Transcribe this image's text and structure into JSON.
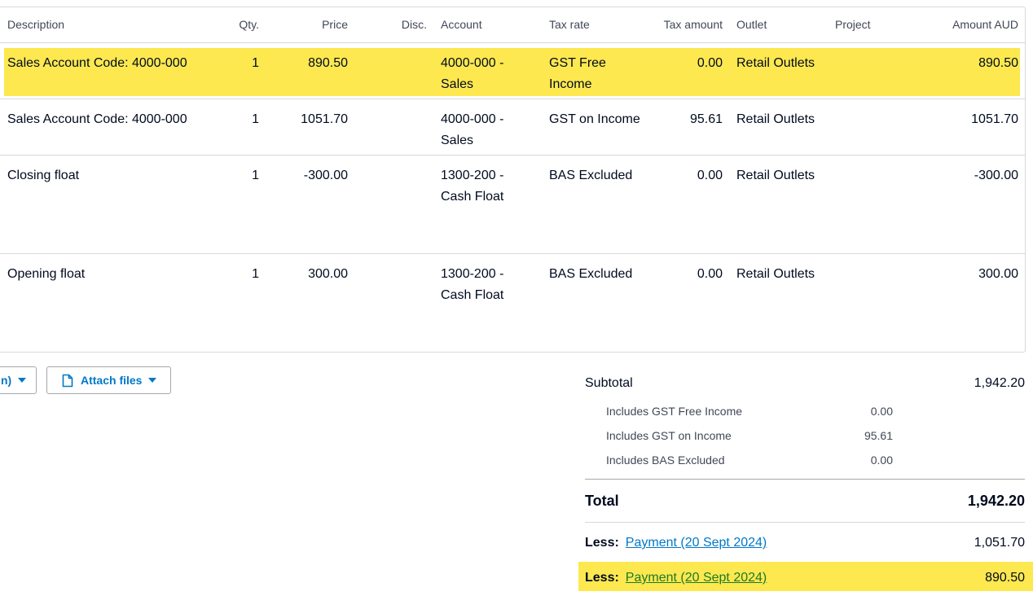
{
  "table": {
    "headers": {
      "description": "Description",
      "qty": "Qty.",
      "price": "Price",
      "disc": "Disc.",
      "account": "Account",
      "tax_rate": "Tax rate",
      "tax_amount": "Tax amount",
      "outlet": "Outlet",
      "project": "Project",
      "amount": "Amount AUD"
    },
    "rows": [
      {
        "description": "Sales Account Code: 4000-000",
        "qty": "1",
        "price": "890.50",
        "disc": "",
        "account_line1": "4000-000 -",
        "account_line2": "Sales",
        "tax_line1": "GST Free",
        "tax_line2": "Income",
        "tax_amount": "0.00",
        "outlet": "Retail Outlets",
        "project": "",
        "amount": "890.50",
        "highlighted": true
      },
      {
        "description": "Sales Account Code: 4000-000",
        "qty": "1",
        "price": "1051.70",
        "disc": "",
        "account_line1": "4000-000 -",
        "account_line2": "Sales",
        "tax_line1": "GST on Income",
        "tax_line2": "",
        "tax_amount": "95.61",
        "outlet": "Retail Outlets",
        "project": "",
        "amount": "1051.70",
        "highlighted": false
      },
      {
        "description": "Closing float",
        "qty": "1",
        "price": "-300.00",
        "disc": "",
        "account_line1": "1300-200 -",
        "account_line2": "Cash Float",
        "tax_line1": "BAS Excluded",
        "tax_line2": "",
        "tax_amount": "0.00",
        "outlet": "Retail Outlets",
        "project": "",
        "amount": "-300.00",
        "highlighted": false
      },
      {
        "description": "Opening float",
        "qty": "1",
        "price": "300.00",
        "disc": "",
        "account_line1": "1300-200 -",
        "account_line2": "Cash Float",
        "tax_line1": "BAS Excluded",
        "tax_line2": "",
        "tax_amount": "0.00",
        "outlet": "Retail Outlets",
        "project": "",
        "amount": "300.00",
        "highlighted": false
      }
    ]
  },
  "actions": {
    "left_button_label": "n)",
    "attach_label": "Attach files",
    "icons": {
      "caret": "chevron-down-icon",
      "attach": "document-icon"
    }
  },
  "totals": {
    "subtotal_label": "Subtotal",
    "subtotal_value": "1,942.20",
    "includes": [
      {
        "label": "Includes GST Free Income",
        "value": "0.00"
      },
      {
        "label": "Includes GST on Income",
        "value": "95.61"
      },
      {
        "label": "Includes BAS Excluded",
        "value": "0.00"
      }
    ],
    "total_label": "Total",
    "total_value": "1,942.20",
    "payments": [
      {
        "less_label": "Less:",
        "link_text": "Payment (20 Sept 2024)",
        "value": "1,051.70",
        "highlighted": false
      },
      {
        "less_label": "Less:",
        "link_text": "Payment (20 Sept 2024)",
        "value": "890.50",
        "highlighted": true
      }
    ]
  },
  "colors": {
    "highlight": "#fde84f",
    "link_blue": "#0078c8",
    "link_green": "#1c7a2a",
    "border": "#d6d9dc"
  }
}
